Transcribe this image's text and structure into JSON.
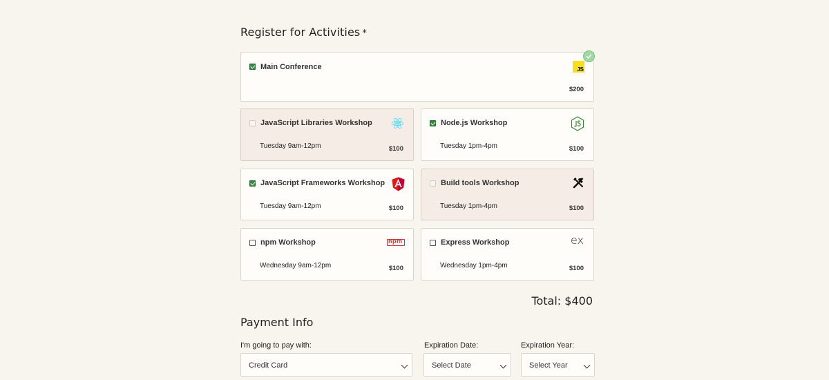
{
  "register": {
    "heading": "Register for Activities",
    "required_mark": "*"
  },
  "activities": [
    {
      "name": "Main Conference",
      "time": "",
      "cost": "$200",
      "checked": true,
      "disabled": false,
      "icon": "js-icon"
    },
    {
      "name": "JavaScript Libraries Workshop",
      "time": "Tuesday 9am-12pm",
      "cost": "$100",
      "checked": false,
      "disabled": true,
      "icon": "react-icon"
    },
    {
      "name": "Node.js Workshop",
      "time": "Tuesday 1pm-4pm",
      "cost": "$100",
      "checked": true,
      "disabled": false,
      "icon": "nodejs-icon"
    },
    {
      "name": "JavaScript Frameworks Workshop",
      "time": "Tuesday 9am-12pm",
      "cost": "$100",
      "checked": true,
      "disabled": false,
      "icon": "angular-icon"
    },
    {
      "name": "Build tools Workshop",
      "time": "Tuesday 1pm-4pm",
      "cost": "$100",
      "checked": false,
      "disabled": true,
      "icon": "tools-icon"
    },
    {
      "name": "npm Workshop",
      "time": "Wednesday 9am-12pm",
      "cost": "$100",
      "checked": false,
      "disabled": false,
      "icon": "npm-icon"
    },
    {
      "name": "Express Workshop",
      "time": "Wednesday 1pm-4pm",
      "cost": "$100",
      "checked": false,
      "disabled": false,
      "icon": "express-icon"
    }
  ],
  "total": "Total: $400",
  "payment": {
    "heading": "Payment Info",
    "method_label": "I'm going to pay with:",
    "method_value": "Credit Card",
    "exp_date_label": "Expiration Date:",
    "exp_date_value": "Select Date",
    "exp_year_label": "Expiration Year:",
    "exp_year_value": "Select Year"
  },
  "icon_text": {
    "js": "JS",
    "npm": "npm",
    "express": "ex"
  },
  "colors": {
    "background": "#f8f4ee",
    "checkbox_checked": "#2e8b3d",
    "js_yellow": "#f7df1e",
    "angular_red": "#dd1b16",
    "npm_red": "#cb3837",
    "node_green": "#3c873a",
    "react_blue": "#61dafb"
  }
}
